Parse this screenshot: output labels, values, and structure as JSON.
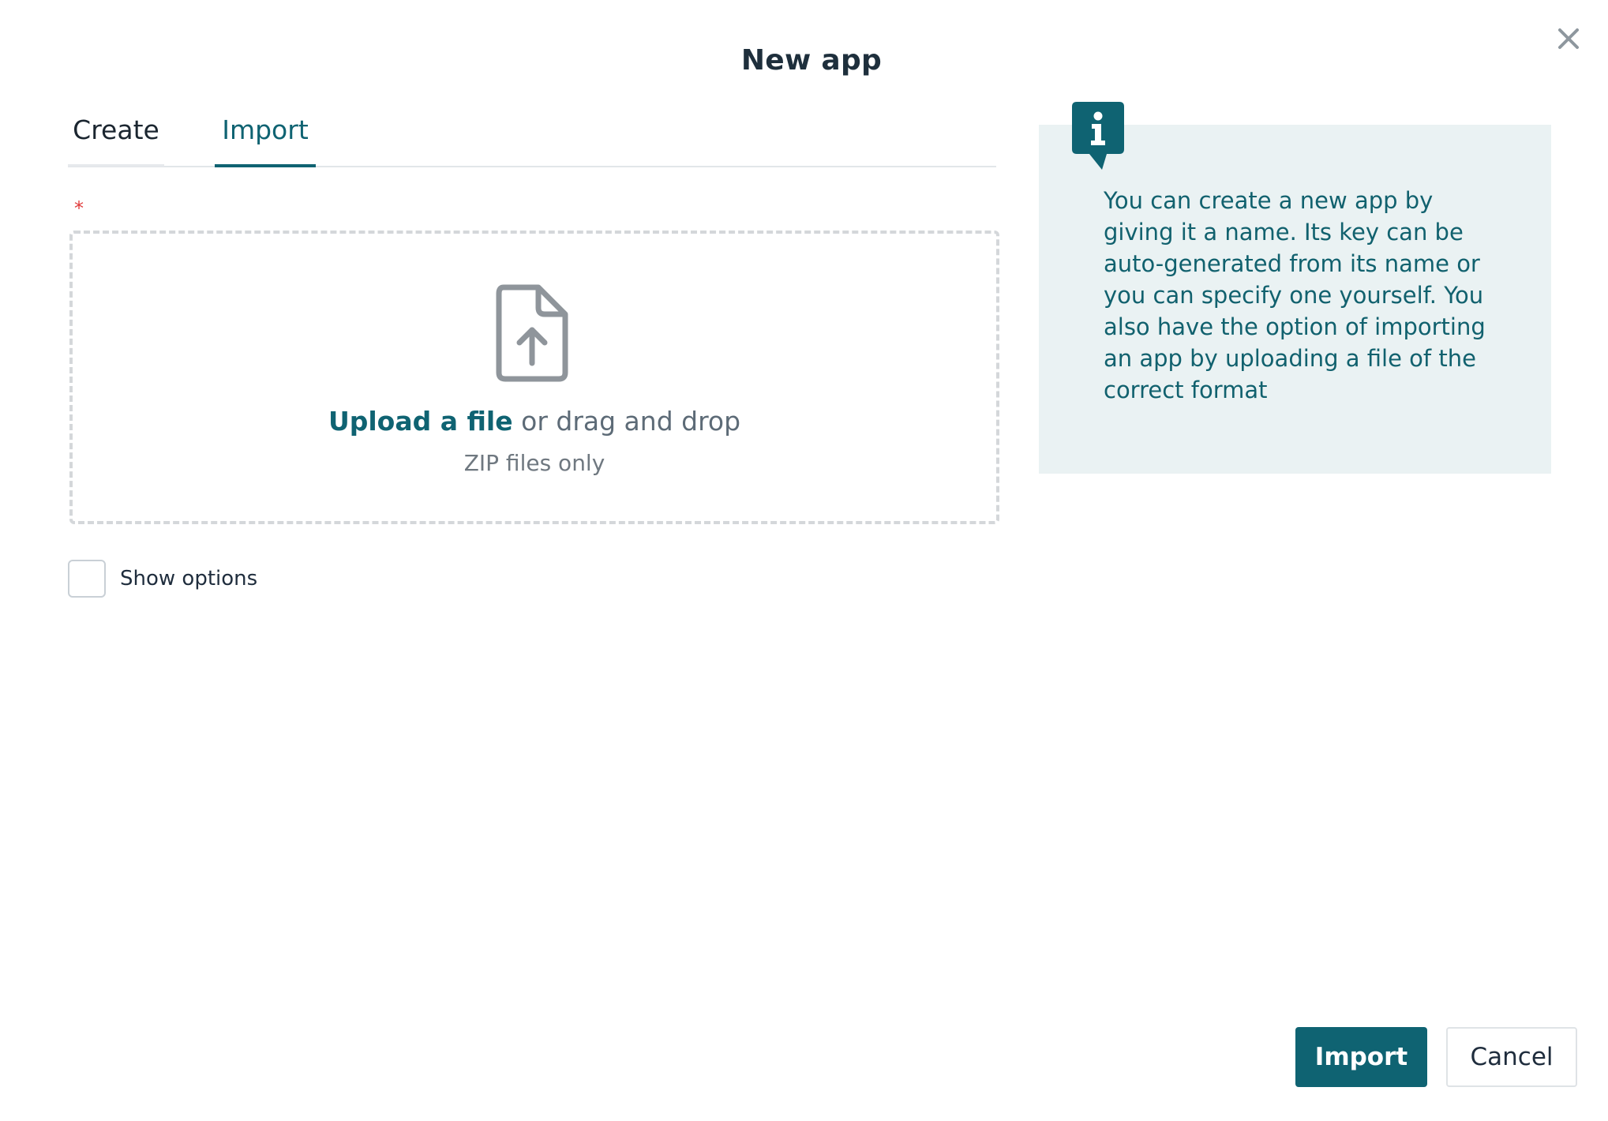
{
  "dialog": {
    "title": "New app",
    "close_icon": "close-icon"
  },
  "tabs": [
    {
      "label": "Create",
      "active": false
    },
    {
      "label": "Import",
      "active": true
    }
  ],
  "form": {
    "required_marker": "*",
    "dropzone": {
      "icon": "file-upload-icon",
      "link_text": "Upload a file",
      "rest_text": " or drag and drop",
      "hint": "ZIP files only"
    },
    "show_options": {
      "label": "Show options",
      "checked": false
    }
  },
  "info": {
    "icon": "info-icon",
    "text": "You can create a new app by giving it a name. Its key can be auto-generated from its name or you can specify one yourself. You also have the option of importing an app by uploading a file of the correct format"
  },
  "footer": {
    "import_label": "Import",
    "cancel_label": "Cancel"
  },
  "colors": {
    "accent": "#0f6372",
    "info_bg": "#eaf2f3",
    "required": "#e03b3b"
  }
}
